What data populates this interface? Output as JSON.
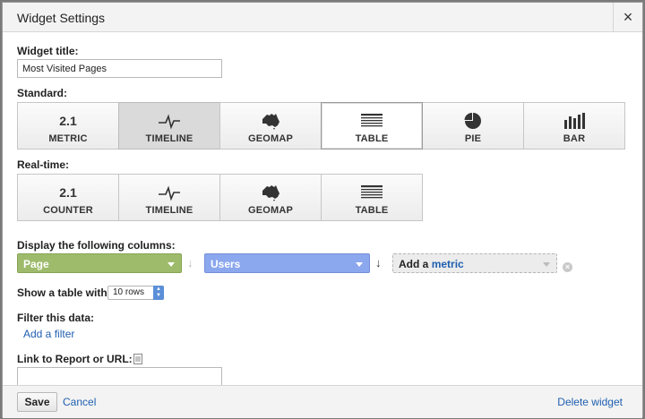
{
  "dialog": {
    "title": "Widget Settings",
    "close_label": "×"
  },
  "widget_title": {
    "label": "Widget title:",
    "value": "Most Visited Pages"
  },
  "standard": {
    "label": "Standard:",
    "tiles": [
      {
        "label": "METRIC",
        "icon": "2.1"
      },
      {
        "label": "TIMELINE",
        "icon": "timeline-icon"
      },
      {
        "label": "GEOMAP",
        "icon": "australia-map-icon"
      },
      {
        "label": "TABLE",
        "icon": "table-icon"
      },
      {
        "label": "PIE",
        "icon": "pie-icon"
      },
      {
        "label": "BAR",
        "icon": "bar-chart-icon"
      }
    ],
    "selected": "TABLE"
  },
  "realtime": {
    "label": "Real-time:",
    "tiles": [
      {
        "label": "COUNTER",
        "icon": "2.1"
      },
      {
        "label": "TIMELINE",
        "icon": "timeline-icon"
      },
      {
        "label": "GEOMAP",
        "icon": "australia-map-icon"
      },
      {
        "label": "TABLE",
        "icon": "table-icon"
      }
    ]
  },
  "columns": {
    "label": "Display the following columns:",
    "dimension": "Page",
    "metric": "Users",
    "add_prefix": "Add a",
    "add_metric": "metric"
  },
  "table_rows": {
    "label": "Show a table with",
    "value": "10 rows"
  },
  "filter": {
    "label": "Filter this data:",
    "add_filter": "Add a filter"
  },
  "link": {
    "label": "Link to Report or URL:",
    "value": ""
  },
  "footer": {
    "save": "Save",
    "cancel": "Cancel",
    "delete": "Delete widget"
  },
  "colors": {
    "dimension": "#9ebb6c",
    "metric": "#8ba7ed",
    "link": "#1f5fb0"
  }
}
